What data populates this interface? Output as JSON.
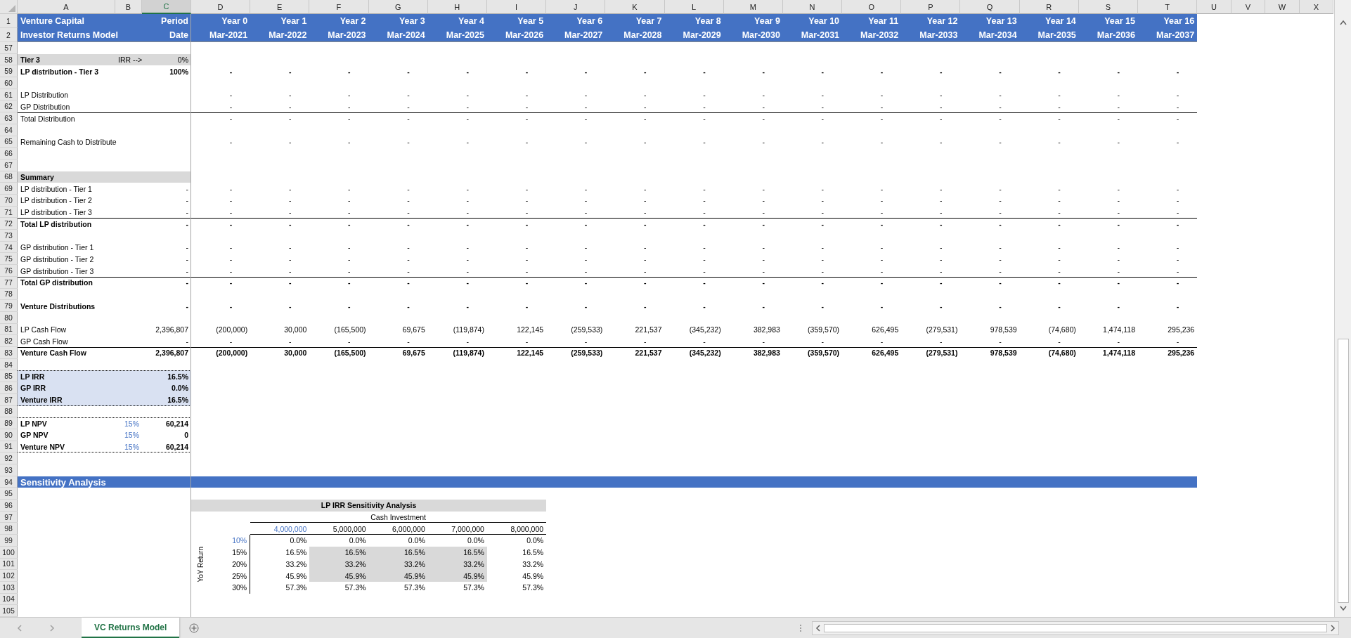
{
  "column_headers": [
    {
      "label": "A",
      "selected": false
    },
    {
      "label": "B",
      "selected": false
    },
    {
      "label": "C",
      "selected": true
    },
    {
      "label": "D",
      "selected": false
    },
    {
      "label": "E",
      "selected": false
    },
    {
      "label": "F",
      "selected": false
    },
    {
      "label": "G",
      "selected": false
    },
    {
      "label": "H",
      "selected": false
    },
    {
      "label": "I",
      "selected": false
    },
    {
      "label": "J",
      "selected": false
    },
    {
      "label": "K",
      "selected": false
    },
    {
      "label": "L",
      "selected": false
    },
    {
      "label": "M",
      "selected": false
    },
    {
      "label": "N",
      "selected": false
    },
    {
      "label": "O",
      "selected": false
    },
    {
      "label": "P",
      "selected": false
    },
    {
      "label": "Q",
      "selected": false
    },
    {
      "label": "R",
      "selected": false
    },
    {
      "label": "S",
      "selected": false
    },
    {
      "label": "T",
      "selected": false
    },
    {
      "label": "U",
      "selected": false
    },
    {
      "label": "V",
      "selected": false
    },
    {
      "label": "W",
      "selected": false
    },
    {
      "label": "X",
      "selected": false
    }
  ],
  "header_rows": [
    {
      "num": "1",
      "title": "Venture Capital",
      "c": "Period",
      "values": [
        "Year 0",
        "Year 1",
        "Year 2",
        "Year 3",
        "Year 4",
        "Year 5",
        "Year 6",
        "Year 7",
        "Year 8",
        "Year 9",
        "Year 10",
        "Year 11",
        "Year 12",
        "Year 13",
        "Year 14",
        "Year 15",
        "Year 16"
      ]
    },
    {
      "num": "2",
      "title": "Investor Returns Model",
      "c": "Date",
      "values": [
        "Mar-2021",
        "Mar-2022",
        "Mar-2023",
        "Mar-2024",
        "Mar-2025",
        "Mar-2026",
        "Mar-2027",
        "Mar-2028",
        "Mar-2029",
        "Mar-2030",
        "Mar-2031",
        "Mar-2032",
        "Mar-2033",
        "Mar-2034",
        "Mar-2035",
        "Mar-2036",
        "Mar-2037"
      ]
    }
  ],
  "rows": [
    {
      "num": "57",
      "kind": "blank"
    },
    {
      "num": "58",
      "kind": "section",
      "label": "Tier 3",
      "b": "IRR -->",
      "c": "0%"
    },
    {
      "num": "59",
      "kind": "line",
      "label": "LP distribution - Tier 3",
      "c": "100%",
      "bold": true,
      "rule_above": false,
      "values": [
        "-",
        "-",
        "-",
        "-",
        "-",
        "-",
        "-",
        "-",
        "-",
        "-",
        "-",
        "-",
        "-",
        "-",
        "-",
        "-",
        "-"
      ]
    },
    {
      "num": "60",
      "kind": "blank"
    },
    {
      "num": "61",
      "kind": "line",
      "label": "LP Distribution",
      "bold": false,
      "rule_above": false,
      "values": [
        "-",
        "-",
        "-",
        "-",
        "-",
        "-",
        "-",
        "-",
        "-",
        "-",
        "-",
        "-",
        "-",
        "-",
        "-",
        "-",
        "-"
      ]
    },
    {
      "num": "62",
      "kind": "line",
      "label": "GP Distribution",
      "bold": false,
      "rule_above": false,
      "values": [
        "-",
        "-",
        "-",
        "-",
        "-",
        "-",
        "-",
        "-",
        "-",
        "-",
        "-",
        "-",
        "-",
        "-",
        "-",
        "-",
        "-"
      ]
    },
    {
      "num": "63",
      "kind": "line",
      "label": "Total Distribution",
      "bold": false,
      "rule_above": true,
      "values": [
        "-",
        "-",
        "-",
        "-",
        "-",
        "-",
        "-",
        "-",
        "-",
        "-",
        "-",
        "-",
        "-",
        "-",
        "-",
        "-",
        "-"
      ]
    },
    {
      "num": "64",
      "kind": "blank"
    },
    {
      "num": "65",
      "kind": "line",
      "label": "Remaining Cash to Distribute",
      "bold": false,
      "rule_above": false,
      "values": [
        "-",
        "-",
        "-",
        "-",
        "-",
        "-",
        "-",
        "-",
        "-",
        "-",
        "-",
        "-",
        "-",
        "-",
        "-",
        "-",
        "-"
      ]
    },
    {
      "num": "66",
      "kind": "blank"
    },
    {
      "num": "67",
      "kind": "blank"
    },
    {
      "num": "68",
      "kind": "section",
      "label": "Summary"
    },
    {
      "num": "69",
      "kind": "line",
      "label": "LP distribution - Tier 1",
      "c": "-",
      "bold": false,
      "rule_above": false,
      "values": [
        "-",
        "-",
        "-",
        "-",
        "-",
        "-",
        "-",
        "-",
        "-",
        "-",
        "-",
        "-",
        "-",
        "-",
        "-",
        "-",
        "-"
      ]
    },
    {
      "num": "70",
      "kind": "line",
      "label": "LP distribution - Tier 2",
      "c": "-",
      "bold": false,
      "rule_above": false,
      "values": [
        "-",
        "-",
        "-",
        "-",
        "-",
        "-",
        "-",
        "-",
        "-",
        "-",
        "-",
        "-",
        "-",
        "-",
        "-",
        "-",
        "-"
      ]
    },
    {
      "num": "71",
      "kind": "line",
      "label": "LP distribution - Tier 3",
      "c": "-",
      "bold": false,
      "rule_above": false,
      "values": [
        "-",
        "-",
        "-",
        "-",
        "-",
        "-",
        "-",
        "-",
        "-",
        "-",
        "-",
        "-",
        "-",
        "-",
        "-",
        "-",
        "-"
      ]
    },
    {
      "num": "72",
      "kind": "line",
      "label": "Total LP distribution",
      "c": "-",
      "bold": true,
      "rule_above": true,
      "values": [
        "-",
        "-",
        "-",
        "-",
        "-",
        "-",
        "-",
        "-",
        "-",
        "-",
        "-",
        "-",
        "-",
        "-",
        "-",
        "-",
        "-"
      ]
    },
    {
      "num": "73",
      "kind": "blank"
    },
    {
      "num": "74",
      "kind": "line",
      "label": "GP distribution - Tier 1",
      "c": "-",
      "bold": false,
      "rule_above": false,
      "values": [
        "-",
        "-",
        "-",
        "-",
        "-",
        "-",
        "-",
        "-",
        "-",
        "-",
        "-",
        "-",
        "-",
        "-",
        "-",
        "-",
        "-"
      ]
    },
    {
      "num": "75",
      "kind": "line",
      "label": "GP distribution - Tier 2",
      "c": "-",
      "bold": false,
      "rule_above": false,
      "values": [
        "-",
        "-",
        "-",
        "-",
        "-",
        "-",
        "-",
        "-",
        "-",
        "-",
        "-",
        "-",
        "-",
        "-",
        "-",
        "-",
        "-"
      ]
    },
    {
      "num": "76",
      "kind": "line",
      "label": "GP distribution - Tier 3",
      "c": "-",
      "bold": false,
      "rule_above": false,
      "values": [
        "-",
        "-",
        "-",
        "-",
        "-",
        "-",
        "-",
        "-",
        "-",
        "-",
        "-",
        "-",
        "-",
        "-",
        "-",
        "-",
        "-"
      ]
    },
    {
      "num": "77",
      "kind": "line",
      "label": "Total GP distribution",
      "c": "-",
      "bold": true,
      "rule_above": true,
      "values": [
        "-",
        "-",
        "-",
        "-",
        "-",
        "-",
        "-",
        "-",
        "-",
        "-",
        "-",
        "-",
        "-",
        "-",
        "-",
        "-",
        "-"
      ]
    },
    {
      "num": "78",
      "kind": "blank"
    },
    {
      "num": "79",
      "kind": "line",
      "label": "Venture Distributions",
      "c": "-",
      "bold": true,
      "rule_above": false,
      "values": [
        "-",
        "-",
        "-",
        "-",
        "-",
        "-",
        "-",
        "-",
        "-",
        "-",
        "-",
        "-",
        "-",
        "-",
        "-",
        "-",
        "-"
      ]
    },
    {
      "num": "80",
      "kind": "blank"
    },
    {
      "num": "81",
      "kind": "line",
      "label": "LP Cash Flow",
      "c": "2,396,807",
      "bold": false,
      "rule_above": false,
      "values": [
        "(200,000)",
        "30,000",
        "(165,500)",
        "69,675",
        "(119,874)",
        "122,145",
        "(259,533)",
        "221,537",
        "(345,232)",
        "382,983",
        "(359,570)",
        "626,495",
        "(279,531)",
        "978,539",
        "(74,680)",
        "1,474,118",
        "295,236"
      ]
    },
    {
      "num": "82",
      "kind": "line",
      "label": "GP Cash Flow",
      "c": "-",
      "bold": false,
      "rule_above": false,
      "values": [
        "-",
        "-",
        "-",
        "-",
        "-",
        "-",
        "-",
        "-",
        "-",
        "-",
        "-",
        "-",
        "-",
        "-",
        "-",
        "-",
        "-"
      ]
    },
    {
      "num": "83",
      "kind": "line",
      "label": "Venture Cash Flow",
      "c": "2,396,807",
      "bold": true,
      "rule_above": true,
      "values": [
        "(200,000)",
        "30,000",
        "(165,500)",
        "69,675",
        "(119,874)",
        "122,145",
        "(259,533)",
        "221,537",
        "(345,232)",
        "382,983",
        "(359,570)",
        "626,495",
        "(279,531)",
        "978,539",
        "(74,680)",
        "1,474,118",
        "295,236"
      ]
    },
    {
      "num": "84",
      "kind": "blank"
    },
    {
      "num": "85",
      "kind": "metric",
      "label": "LP IRR",
      "c": "16.5%",
      "shaded": true,
      "dotted_top": true,
      "dotted_bottom": false
    },
    {
      "num": "86",
      "kind": "metric",
      "label": "GP IRR",
      "c": "0.0%",
      "shaded": true,
      "dotted_top": false,
      "dotted_bottom": false
    },
    {
      "num": "87",
      "kind": "metric",
      "label": "Venture IRR",
      "c": "16.5%",
      "shaded": true,
      "dotted_top": false,
      "dotted_bottom": true
    },
    {
      "num": "88",
      "kind": "blank"
    },
    {
      "num": "89",
      "kind": "metric",
      "label": "LP NPV",
      "b": "15%",
      "c": "60,214",
      "shaded": false,
      "dotted_top": true,
      "dotted_bottom": false
    },
    {
      "num": "90",
      "kind": "metric",
      "label": "GP NPV",
      "b": "15%",
      "c": "0",
      "shaded": false,
      "dotted_top": false,
      "dotted_bottom": false
    },
    {
      "num": "91",
      "kind": "metric",
      "label": "Venture NPV",
      "b": "15%",
      "c": "60,214",
      "shaded": false,
      "dotted_top": false,
      "dotted_bottom": true
    },
    {
      "num": "92",
      "kind": "blank"
    },
    {
      "num": "93",
      "kind": "blank"
    },
    {
      "num": "94",
      "kind": "band",
      "label": "Sensitivity Analysis"
    },
    {
      "num": "95",
      "kind": "blank"
    },
    {
      "num": "96",
      "kind": "sens_title",
      "label": "LP IRR Sensitivity Analysis"
    },
    {
      "num": "97",
      "kind": "sens_axis",
      "label": "Cash Investment"
    },
    {
      "num": "98",
      "kind": "sens_head",
      "axis": "YoY Return",
      "columns": [
        {
          "label": "4,000,000",
          "input": true
        },
        {
          "label": "5,000,000",
          "input": false
        },
        {
          "label": "6,000,000",
          "input": false
        },
        {
          "label": "7,000,000",
          "input": false
        },
        {
          "label": "8,000,000",
          "input": false
        }
      ]
    },
    {
      "num": "99",
      "kind": "sens_row",
      "rate": "10%",
      "input": true,
      "cells": [
        {
          "value": "0.0%",
          "shaded": false
        },
        {
          "value": "0.0%",
          "shaded": false
        },
        {
          "value": "0.0%",
          "shaded": false
        },
        {
          "value": "0.0%",
          "shaded": false
        },
        {
          "value": "0.0%",
          "shaded": false
        }
      ]
    },
    {
      "num": "100",
      "kind": "sens_row",
      "rate": "15%",
      "input": false,
      "cells": [
        {
          "value": "16.5%",
          "shaded": false
        },
        {
          "value": "16.5%",
          "shaded": true
        },
        {
          "value": "16.5%",
          "shaded": true
        },
        {
          "value": "16.5%",
          "shaded": true
        },
        {
          "value": "16.5%",
          "shaded": false
        }
      ]
    },
    {
      "num": "101",
      "kind": "sens_row",
      "rate": "20%",
      "input": false,
      "cells": [
        {
          "value": "33.2%",
          "shaded": false
        },
        {
          "value": "33.2%",
          "shaded": true
        },
        {
          "value": "33.2%",
          "shaded": true
        },
        {
          "value": "33.2%",
          "shaded": true
        },
        {
          "value": "33.2%",
          "shaded": false
        }
      ]
    },
    {
      "num": "102",
      "kind": "sens_row",
      "rate": "25%",
      "input": false,
      "cells": [
        {
          "value": "45.9%",
          "shaded": false
        },
        {
          "value": "45.9%",
          "shaded": true
        },
        {
          "value": "45.9%",
          "shaded": true
        },
        {
          "value": "45.9%",
          "shaded": true
        },
        {
          "value": "45.9%",
          "shaded": false
        }
      ]
    },
    {
      "num": "103",
      "kind": "sens_row",
      "rate": "30%",
      "input": false,
      "cells": [
        {
          "value": "57.3%",
          "shaded": false
        },
        {
          "value": "57.3%",
          "shaded": false
        },
        {
          "value": "57.3%",
          "shaded": false
        },
        {
          "value": "57.3%",
          "shaded": false
        },
        {
          "value": "57.3%",
          "shaded": false
        }
      ]
    },
    {
      "num": "104",
      "kind": "blank"
    },
    {
      "num": "105",
      "kind": "blank"
    }
  ],
  "sheet_tabs": [
    {
      "label": "VC Returns Model",
      "selected": true
    }
  ]
}
